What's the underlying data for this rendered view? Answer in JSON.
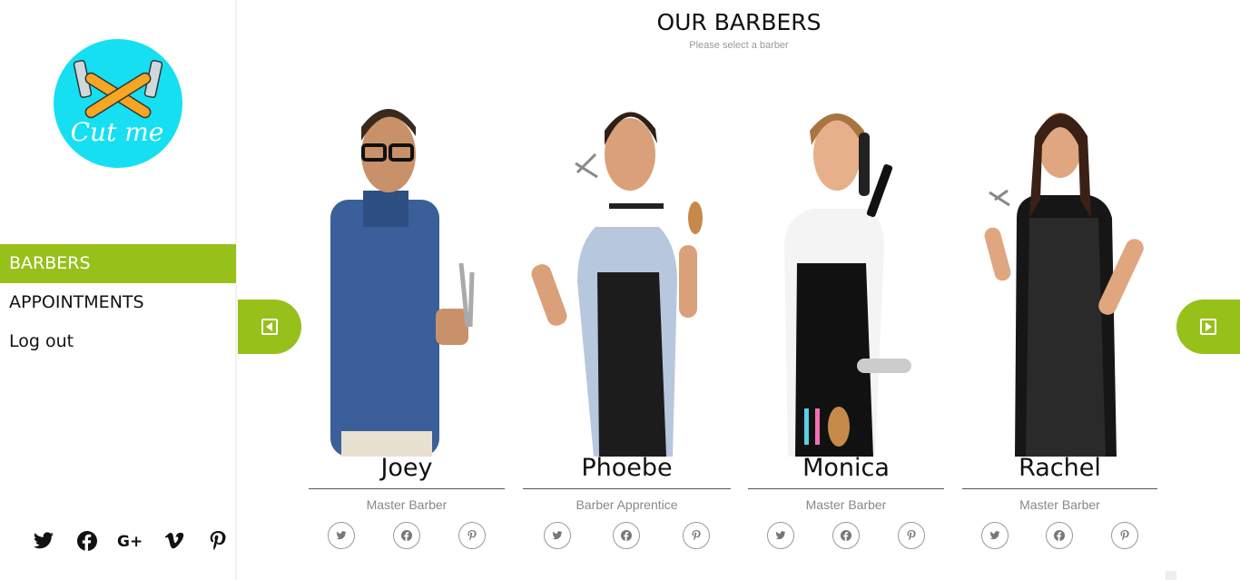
{
  "sidebar": {
    "logo_text": "Cut me",
    "nav": [
      {
        "label": "BARBERS",
        "active": true
      },
      {
        "label": "APPOINTMENTS",
        "active": false
      },
      {
        "label": "Log out",
        "active": false
      }
    ],
    "social_icons": [
      "twitter-icon",
      "facebook-icon",
      "google-plus-icon",
      "vimeo-icon",
      "pinterest-icon"
    ]
  },
  "main": {
    "title": "OUR BARBERS",
    "subtitle": "Please select a barber",
    "barbers": [
      {
        "name": "Joey",
        "role": "Master Barber"
      },
      {
        "name": "Phoebe",
        "role": "Barber Apprentice"
      },
      {
        "name": "Monica",
        "role": "Master Barber"
      },
      {
        "name": "Rachel",
        "role": "Master Barber"
      }
    ],
    "card_icons": [
      "twitter-icon",
      "facebook-icon",
      "pinterest-icon"
    ]
  },
  "colors": {
    "accent": "#97c01b",
    "logo_bg": "#16dff2"
  }
}
